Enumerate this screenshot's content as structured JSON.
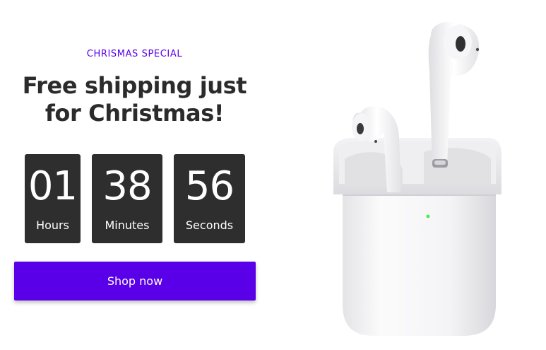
{
  "promo": {
    "eyebrow": "CHRISMAS SPECIAL",
    "headline_line1": "Free shipping just",
    "headline_line2": "for Christmas!"
  },
  "countdown": [
    {
      "value": "01",
      "label": "Hours"
    },
    {
      "value": "38",
      "label": "Minutes"
    },
    {
      "value": "56",
      "label": "Seconds"
    }
  ],
  "cta": {
    "label": "Shop now"
  },
  "colors": {
    "accent": "#5a00e8",
    "timer_bg": "#2e2e2e",
    "heading": "#2b2b2b",
    "led": "#3cf04a"
  },
  "product_image": {
    "icon": "airpods-charging-case-image"
  }
}
